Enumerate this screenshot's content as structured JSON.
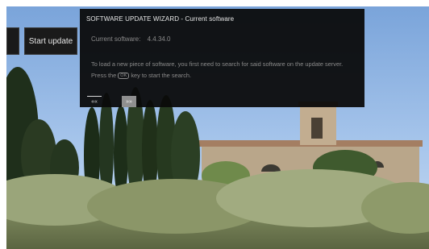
{
  "sidebar": {
    "start_update_label": "Start update"
  },
  "dialog": {
    "title": "SOFTWARE UPDATE WIZARD - Current software",
    "current_software_label": "Current software:",
    "current_software_version": "4.4.34.0",
    "message_part1": "To load a new piece of software, you first need to search for said software on the update server. Press the",
    "ok_key_label": "OK",
    "message_part2": "key to start the search.",
    "prev_icon": "««",
    "next_icon": "»»"
  },
  "colors": {
    "dialog_bg": "#0a0a0a",
    "text_primary": "#e6e6e6",
    "text_secondary": "#8a8a8a",
    "nav_selected": "#8f8f8f"
  }
}
